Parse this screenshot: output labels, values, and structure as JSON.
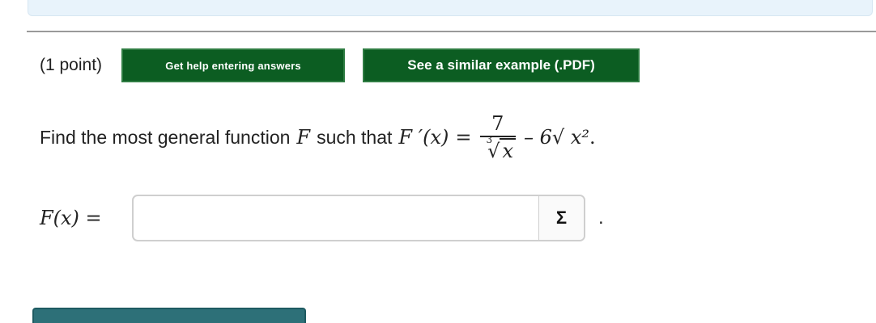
{
  "problem": {
    "points_label": "(1 point)",
    "help_button_label": "Get help entering answers",
    "example_button_label": "See a similar example (.PDF)",
    "question": {
      "prefix": "Find the most general function",
      "fn_symbol": "F",
      "mid": "such that",
      "derivative_lhs": "F ′(x)",
      "equals": "=",
      "numerator": "7",
      "root_index": "3",
      "radical_sign": "√",
      "radicand": "x",
      "minus_term": "– 6√ x²",
      "period": "."
    },
    "answer": {
      "label": "F(x) =",
      "value": "",
      "placeholder": "",
      "equation_editor_icon": "sigma-icon",
      "equation_editor_glyph": "Σ",
      "trailing": "."
    }
  },
  "colors": {
    "button_green": "#0c5d22",
    "submit_teal": "#2d7078",
    "banner": "#e8f3fb"
  }
}
